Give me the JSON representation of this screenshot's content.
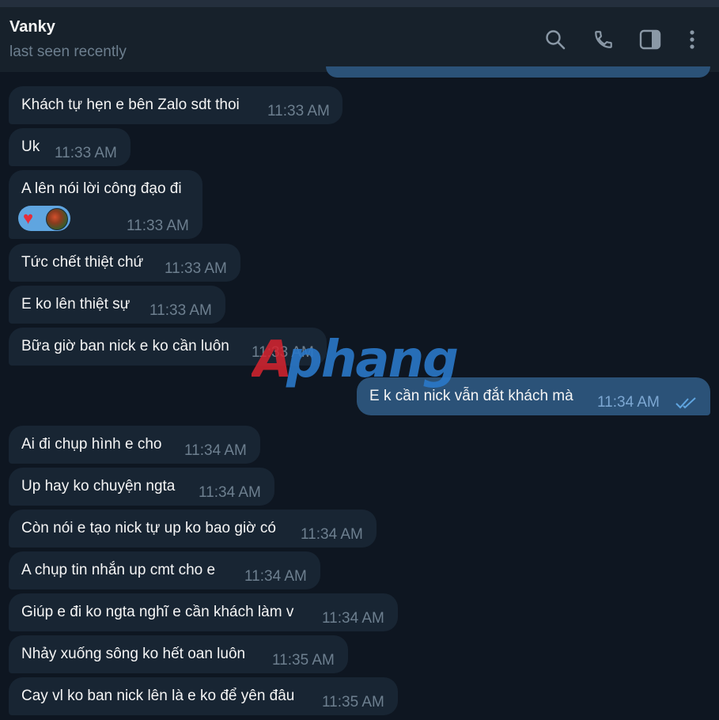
{
  "header": {
    "name": "Vanky",
    "status": "last seen recently",
    "icons": [
      "search-icon",
      "phone-icon",
      "sidebar-toggle-icon",
      "more-vertical-icon"
    ]
  },
  "colors": {
    "background": "#0e1621",
    "header": "#17212b",
    "incoming_bubble": "#182533",
    "outgoing_bubble": "#2b5278",
    "time_text": "#6d7f8f",
    "read_ticks": "#5fa5e0"
  },
  "messages": [
    {
      "dir": "in",
      "text": "Khách tự hẹn e bên Zalo sdt thoi",
      "time": "11:33 AM"
    },
    {
      "dir": "in",
      "text": "Uk",
      "time": "11:33 AM"
    },
    {
      "dir": "in",
      "text": "A lên nói lời công đạo đi",
      "time": "11:33 AM",
      "reaction": "heart"
    },
    {
      "dir": "in",
      "text": "Tức chết thiệt chứ",
      "time": "11:33 AM"
    },
    {
      "dir": "in",
      "text": "E ko lên thiệt sự",
      "time": "11:33 AM"
    },
    {
      "dir": "in",
      "text": "Bữa giờ ban nick e ko cần luôn",
      "time": "11:33 AM"
    },
    {
      "dir": "out",
      "text": "E k cần nick vẫn đắt khách mà",
      "time": "11:34 AM",
      "status": "read"
    },
    {
      "dir": "in",
      "text": "Ai đi chụp hình e cho",
      "time": "11:34 AM"
    },
    {
      "dir": "in",
      "text": "Up hay ko chuyện ngta",
      "time": "11:34 AM"
    },
    {
      "dir": "in",
      "text": "Còn nói e tạo nick tự up ko bao giờ có",
      "time": "11:34 AM"
    },
    {
      "dir": "in",
      "text": "A chụp tin nhắn up cmt cho e",
      "time": "11:34 AM"
    },
    {
      "dir": "in",
      "text": "Giúp e đi ko ngta nghĩ e cần khách làm v",
      "time": "11:34 AM"
    },
    {
      "dir": "in",
      "text": "Nhảy xuống sông ko hết oan luôn",
      "time": "11:35 AM"
    },
    {
      "dir": "in",
      "text": "Cay vl ko ban nick lên là e ko để yên đâu",
      "time": "11:35 AM"
    }
  ],
  "watermark": "Aphang"
}
